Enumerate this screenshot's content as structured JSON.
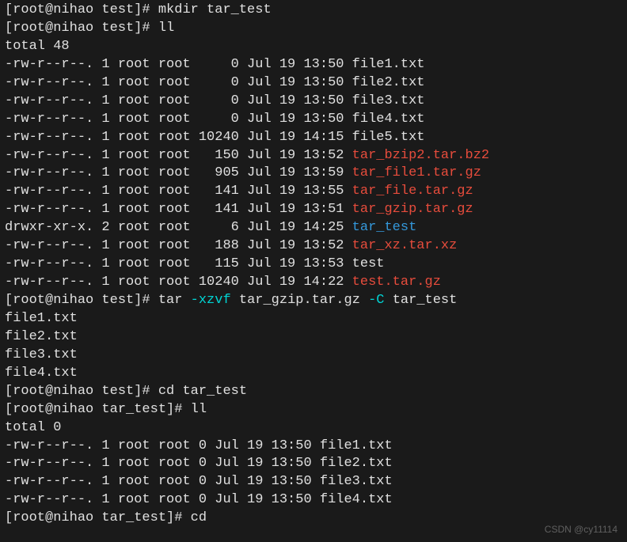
{
  "prompts": {
    "user_host_test": "[root@nihao test]# ",
    "user_host_tartest": "[root@nihao tar_test]# "
  },
  "commands": {
    "mkdir": "mkdir tar_test",
    "ll": "ll",
    "tar_prefix": "tar ",
    "tar_xzvf": "-xzvf ",
    "tar_file": "tar_gzip.tar.gz ",
    "tar_C": "-C ",
    "tar_dest": "tar_test",
    "cd_tartest": "cd tar_test",
    "cd": "cd"
  },
  "totals": {
    "t48": "total 48",
    "t0": "total 0"
  },
  "rows1": [
    {
      "perm": "-rw-r--r--. 1 root root     0 Jul 19 13:50 ",
      "name": "file1.txt",
      "cls": "file-default"
    },
    {
      "perm": "-rw-r--r--. 1 root root     0 Jul 19 13:50 ",
      "name": "file2.txt",
      "cls": "file-default"
    },
    {
      "perm": "-rw-r--r--. 1 root root     0 Jul 19 13:50 ",
      "name": "file3.txt",
      "cls": "file-default"
    },
    {
      "perm": "-rw-r--r--. 1 root root     0 Jul 19 13:50 ",
      "name": "file4.txt",
      "cls": "file-default"
    },
    {
      "perm": "-rw-r--r--. 1 root root 10240 Jul 19 14:15 ",
      "name": "file5.txt",
      "cls": "file-default"
    },
    {
      "perm": "-rw-r--r--. 1 root root   150 Jul 19 13:52 ",
      "name": "tar_bzip2.tar.bz2",
      "cls": "file-red"
    },
    {
      "perm": "-rw-r--r--. 1 root root   905 Jul 19 13:59 ",
      "name": "tar_file1.tar.gz",
      "cls": "file-red"
    },
    {
      "perm": "-rw-r--r--. 1 root root   141 Jul 19 13:55 ",
      "name": "tar_file.tar.gz",
      "cls": "file-red"
    },
    {
      "perm": "-rw-r--r--. 1 root root   141 Jul 19 13:51 ",
      "name": "tar_gzip.tar.gz",
      "cls": "file-red"
    },
    {
      "perm": "drwxr-xr-x. 2 root root     6 Jul 19 14:25 ",
      "name": "tar_test",
      "cls": "file-blue"
    },
    {
      "perm": "-rw-r--r--. 1 root root   188 Jul 19 13:52 ",
      "name": "tar_xz.tar.xz",
      "cls": "file-red"
    },
    {
      "perm": "-rw-r--r--. 1 root root   115 Jul 19 13:53 ",
      "name": "test",
      "cls": "file-default"
    },
    {
      "perm": "-rw-r--r--. 1 root root 10240 Jul 19 14:22 ",
      "name": "test.tar.gz",
      "cls": "file-red"
    }
  ],
  "extracted": [
    "file1.txt",
    "file2.txt",
    "file3.txt",
    "file4.txt"
  ],
  "rows2": [
    {
      "perm": "-rw-r--r--. 1 root root 0 Jul 19 13:50 ",
      "name": "file1.txt",
      "cls": "file-default"
    },
    {
      "perm": "-rw-r--r--. 1 root root 0 Jul 19 13:50 ",
      "name": "file2.txt",
      "cls": "file-default"
    },
    {
      "perm": "-rw-r--r--. 1 root root 0 Jul 19 13:50 ",
      "name": "file3.txt",
      "cls": "file-default"
    },
    {
      "perm": "-rw-r--r--. 1 root root 0 Jul 19 13:50 ",
      "name": "file4.txt",
      "cls": "file-default"
    }
  ],
  "watermark": "CSDN @cy11114"
}
